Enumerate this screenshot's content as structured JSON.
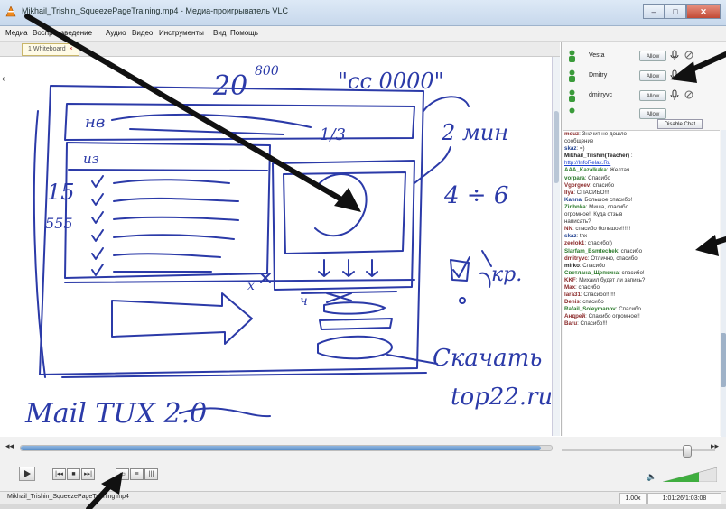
{
  "window": {
    "title": "Mikhail_Trishin_SqueezePageTraining.mp4 - Медиа-проигрыватель VLC",
    "buttons": [
      "–",
      "□",
      "✕"
    ]
  },
  "menu": [
    "Медиа",
    "Воспроизведение",
    "Аудио",
    "Видео",
    "Инструменты",
    "Вид",
    "Помощь"
  ],
  "tab": {
    "label": "1 Whiteboard"
  },
  "whiteboard": {
    "top_number": "20",
    "top_exponent": "800",
    "top_quote": "\"cc 0000\"",
    "left_15": "15",
    "left_555": "555",
    "box_header": "нв",
    "box_iz": "из",
    "fraction": "1/3",
    "time_note": "2 мин",
    "ratio_note": "4 ÷ 6",
    "kr_note": "кр.",
    "download": "Скачать",
    "site": "top22.ru",
    "brand": "Mail TUX 2.0",
    "small_x": "x",
    "small_ch": "ч"
  },
  "users": [
    {
      "name": "Vesta",
      "button": "Allow"
    },
    {
      "name": "Dmitry",
      "button": "Allow"
    },
    {
      "name": "dmitryvc",
      "button": "Allow"
    },
    {
      "name": "",
      "button": "Allow"
    }
  ],
  "disable_chat": "Disable Chat",
  "chat": [
    {
      "nick": "mouz",
      "text": ": Значит не дошло",
      "color": "red"
    },
    {
      "nick": "",
      "text": "сообщение",
      "color": ""
    },
    {
      "nick": "skaz",
      "text": ": =)",
      "color": "blue"
    },
    {
      "nick": "Mikhail_Trishin(Teacher)",
      "text": " :",
      "color": "dark"
    },
    {
      "nick": "",
      "text": "http://InfoRelax.Ru",
      "color": "link"
    },
    {
      "nick": "AAA_Kazalkaka",
      "text": ": Желтая",
      "color": "green"
    },
    {
      "nick": "vorpara",
      "text": ": Спасибо",
      "color": "green"
    },
    {
      "nick": "Vgorgeev",
      "text": ": спасибо",
      "color": "red"
    },
    {
      "nick": "Ilya",
      "text": ": СПАСИБО!!!!",
      "color": "red"
    },
    {
      "nick": "Kanna",
      "text": ": Большое спасибо!",
      "color": "blue"
    },
    {
      "nick": "Zinbnka",
      "text": ": Миша, спасибо",
      "color": "green"
    },
    {
      "nick": "",
      "text": "огромное!! Куда отзыв",
      "color": ""
    },
    {
      "nick": "",
      "text": "написать?",
      "color": ""
    },
    {
      "nick": "NN",
      "text": ": спасибо большое!!!!!!",
      "color": "red"
    },
    {
      "nick": "skaz",
      "text": ": thx",
      "color": "blue"
    },
    {
      "nick": "zeelok1",
      "text": ": спасибо!)",
      "color": "red"
    },
    {
      "nick": "Slarfam_Bsmtechek",
      "text": ": спасибо",
      "color": "green"
    },
    {
      "nick": "dmitryvc",
      "text": ": Отлично, спасибо!",
      "color": "red"
    },
    {
      "nick": "mirko",
      "text": ": Спасибо",
      "color": "dark"
    },
    {
      "nick": "Светлана_Щепкина",
      "text": ": спасибо!",
      "color": "green"
    },
    {
      "nick": "KKF",
      "text": ": Михаил будет ли запись?",
      "color": "red"
    },
    {
      "nick": "Max",
      "text": ": спасибо",
      "color": "red"
    },
    {
      "nick": "lara31",
      "text": ": Спасибо!!!!!!",
      "color": "red"
    },
    {
      "nick": "Denis",
      "text": ": спасибо",
      "color": "red"
    },
    {
      "nick": "Rafail_Soleymanov",
      "text": ": Спасибо",
      "color": "green"
    },
    {
      "nick": "Андрей",
      "text": ": Спасибо огромное!!",
      "color": "red"
    },
    {
      "nick": "Baru",
      "text": ": Спасибо!!!",
      "color": "red"
    }
  ],
  "seek": {
    "left_arrow": "◂◂",
    "right_arrow": "▸▸",
    "progress": 0.98
  },
  "controls": {
    "group1": [
      "|◂◂",
      "■",
      "▸▸|"
    ],
    "group2": [
      "▭",
      "≡",
      "|||"
    ],
    "volume_icon": "🔈"
  },
  "status": {
    "file": "Mikhail_Trishin_SqueezePageTraining.mp4",
    "speed": "1.00x",
    "time": "1:01:26/1:03:08"
  }
}
